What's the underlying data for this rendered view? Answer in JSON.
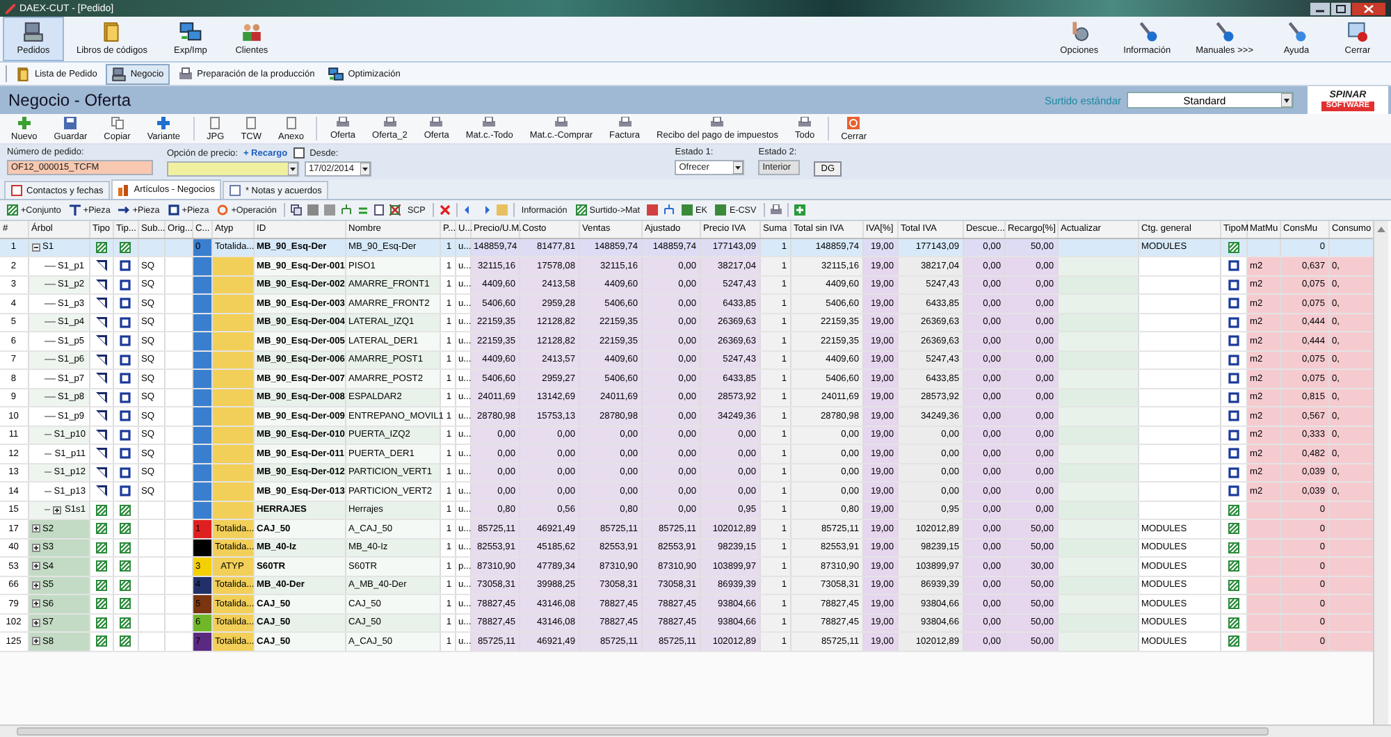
{
  "window": {
    "title": "DAEX-CUT - [Pedido]"
  },
  "ribbon": {
    "items": [
      {
        "label": "Pedidos",
        "selected": true
      },
      {
        "label": "Libros de códigos",
        "selected": false
      },
      {
        "label": "Exp/Imp",
        "selected": false
      },
      {
        "label": "Clientes",
        "selected": false
      }
    ],
    "right_items": [
      "Opciones",
      "Información",
      "Manuales >>>",
      "Ayuda",
      "Cerrar"
    ]
  },
  "nav_tabs": [
    {
      "label": "Lista de Pedido",
      "selected": false
    },
    {
      "label": "Negocio",
      "selected": true
    },
    {
      "label": "Preparación de la producción",
      "selected": false
    },
    {
      "label": "Optimización",
      "selected": false
    }
  ],
  "header": {
    "title": "Negocio - Oferta",
    "assortment_label": "Surtido estándar",
    "assortment_value": "Standard",
    "logo_top": "SPINAR",
    "logo_bottom": "SOFTWARE"
  },
  "toolbar": [
    {
      "kind": "button",
      "label": "Nuevo"
    },
    {
      "kind": "button",
      "label": "Guardar"
    },
    {
      "kind": "button",
      "label": "Copiar"
    },
    {
      "kind": "button",
      "label": "Variante"
    },
    {
      "kind": "separator"
    },
    {
      "kind": "button",
      "label": "JPG"
    },
    {
      "kind": "button",
      "label": "TCW"
    },
    {
      "kind": "button",
      "label": "Anexo"
    },
    {
      "kind": "separator"
    },
    {
      "kind": "button",
      "label": "Oferta"
    },
    {
      "kind": "button",
      "label": "Oferta_2"
    },
    {
      "kind": "button",
      "label": "Oferta"
    },
    {
      "kind": "button",
      "label": "Mat.c.-Todo"
    },
    {
      "kind": "button",
      "label": "Mat.c.-Comprar"
    },
    {
      "kind": "button",
      "label": "Factura"
    },
    {
      "kind": "button",
      "label": "Recibo del pago de impuestos"
    },
    {
      "kind": "button",
      "label": "Todo"
    },
    {
      "kind": "separator"
    },
    {
      "kind": "button",
      "label": "Cerrar"
    }
  ],
  "order": {
    "number_label": "Número de pedido:",
    "number_value": "OF12_000015_TCFM",
    "price_label": "Opción de precio:",
    "surcharge_link": "+ Recargo",
    "from_label": "Desde:",
    "from_checked": false,
    "date": "17/02/2014",
    "state1_label": "Estado 1:",
    "state1_value": "Ofrecer",
    "state2_label": "Estado 2:",
    "state2_value": "Interior",
    "dg_button": "DG"
  },
  "content_tabs": [
    {
      "label": "Contactos y fechas",
      "selected": false
    },
    {
      "label": "Artículos - Negocios",
      "selected": true
    },
    {
      "label": "* Notas y acuerdos",
      "selected": false
    }
  ],
  "grid_toolbar": [
    {
      "kind": "text",
      "label": "+Conjunto"
    },
    {
      "kind": "text",
      "label": "+Pieza"
    },
    {
      "kind": "text",
      "label": "+Pieza"
    },
    {
      "kind": "text",
      "label": "+Pieza"
    },
    {
      "kind": "text",
      "label": "+Operación"
    },
    {
      "kind": "separator"
    },
    {
      "kind": "icon"
    },
    {
      "kind": "icon"
    },
    {
      "kind": "icon"
    },
    {
      "kind": "icon"
    },
    {
      "kind": "icon"
    },
    {
      "kind": "icon"
    },
    {
      "kind": "icon"
    },
    {
      "kind": "text",
      "label": "SCP"
    },
    {
      "kind": "separator"
    },
    {
      "kind": "icon"
    },
    {
      "kind": "separator"
    },
    {
      "kind": "icon"
    },
    {
      "kind": "icon"
    },
    {
      "kind": "icon"
    },
    {
      "kind": "separator"
    },
    {
      "kind": "text",
      "label": "Información"
    },
    {
      "kind": "text",
      "label": "Surtido->Mat"
    },
    {
      "kind": "icon"
    },
    {
      "kind": "icon"
    },
    {
      "kind": "text",
      "label": "EK"
    },
    {
      "kind": "text",
      "label": "E-CSV"
    },
    {
      "kind": "separator"
    },
    {
      "kind": "icon"
    },
    {
      "kind": "separator"
    },
    {
      "kind": "icon"
    }
  ],
  "table": {
    "columns": [
      "#",
      "Árbol",
      "Tipo",
      "Tip...",
      "Sub...",
      "Orig...",
      "C...",
      "Atyp",
      "ID",
      "Nombre",
      "P...",
      "U...",
      "Precio/U.M.",
      "Costo",
      "Ventas",
      "Ajustado",
      "Precio IVA",
      "Suma",
      "Total sin IVA",
      "IVA[%]",
      "Total IVA",
      "Descue...",
      "Recargo[%]",
      "Actualizar",
      "Ctg. general",
      "TipoM",
      "MatMu",
      "ConsMu",
      "Consumo"
    ],
    "rows": [
      {
        "num": "1",
        "tree": "S1",
        "expanded": true,
        "selected": true,
        "tipo": {
          "kind": "set"
        },
        "tip2": {
          "kind": "set"
        },
        "c": "0",
        "color": "#3a7fcf",
        "atyp": "Totalida...",
        "id": "MB_90_Esq-Der",
        "name": "MB_90_Esq-Der",
        "p": "1",
        "u": "u...",
        "values": [
          "148859,74",
          "81477,81",
          "148859,74",
          "148859,74",
          "177143,09",
          "1",
          "148859,74",
          "19,00",
          "177143,09",
          "0,00",
          "50,00"
        ],
        "ctg": "MODULES",
        "tipom": {
          "kind": "set"
        },
        "consmu": "0",
        "children": [
          {
            "num": "2",
            "tree": "S1_p1",
            "selected": false,
            "tipo": {
              "kind": "part"
            },
            "tip2": {
              "kind": "panel"
            },
            "sub": "SQ",
            "color": "#3a7fcf",
            "id": "MB_90_Esq-Der-001",
            "name": "PISO1",
            "p": "1",
            "u": "u...",
            "values": [
              "32115,16",
              "17578,08",
              "32115,16",
              "0,00",
              "38217,04",
              "1",
              "32115,16",
              "19,00",
              "38217,04",
              "0,00",
              "0,00"
            ],
            "tipom": {
              "kind": "panel"
            },
            "matmu": "m2",
            "consmu": "0,637",
            "consumo": "0,"
          },
          {
            "num": "3",
            "tree": "S1_p2",
            "selected": false,
            "tipo": {
              "kind": "part"
            },
            "tip2": {
              "kind": "panel"
            },
            "sub": "SQ",
            "color": "#3a7fcf",
            "id": "MB_90_Esq-Der-002",
            "name": "AMARRE_FRONT1",
            "p": "1",
            "u": "u...",
            "values": [
              "4409,60",
              "2413,58",
              "4409,60",
              "0,00",
              "5247,43",
              "1",
              "4409,60",
              "19,00",
              "5247,43",
              "0,00",
              "0,00"
            ],
            "tipom": {
              "kind": "panel"
            },
            "matmu": "m2",
            "consmu": "0,075",
            "consumo": "0,"
          },
          {
            "num": "4",
            "tree": "S1_p3",
            "selected": false,
            "tipo": {
              "kind": "part"
            },
            "tip2": {
              "kind": "panel"
            },
            "sub": "SQ",
            "color": "#3a7fcf",
            "id": "MB_90_Esq-Der-003",
            "name": "AMARRE_FRONT2",
            "p": "1",
            "u": "u...",
            "values": [
              "5406,60",
              "2959,28",
              "5406,60",
              "0,00",
              "6433,85",
              "1",
              "5406,60",
              "19,00",
              "6433,85",
              "0,00",
              "0,00"
            ],
            "tipom": {
              "kind": "panel"
            },
            "matmu": "m2",
            "consmu": "0,075",
            "consumo": "0,"
          },
          {
            "num": "5",
            "tree": "S1_p4",
            "selected": false,
            "tipo": {
              "kind": "part"
            },
            "tip2": {
              "kind": "panel"
            },
            "sub": "SQ",
            "color": "#3a7fcf",
            "id": "MB_90_Esq-Der-004",
            "name": "LATERAL_IZQ1",
            "p": "1",
            "u": "u...",
            "values": [
              "22159,35",
              "12128,82",
              "22159,35",
              "0,00",
              "26369,63",
              "1",
              "22159,35",
              "19,00",
              "26369,63",
              "0,00",
              "0,00"
            ],
            "tipom": {
              "kind": "panel"
            },
            "matmu": "m2",
            "consmu": "0,444",
            "consumo": "0,"
          },
          {
            "num": "6",
            "tree": "S1_p5",
            "selected": false,
            "tipo": {
              "kind": "part"
            },
            "tip2": {
              "kind": "panel"
            },
            "sub": "SQ",
            "color": "#3a7fcf",
            "id": "MB_90_Esq-Der-005",
            "name": "LATERAL_DER1",
            "p": "1",
            "u": "u...",
            "values": [
              "22159,35",
              "12128,82",
              "22159,35",
              "0,00",
              "26369,63",
              "1",
              "22159,35",
              "19,00",
              "26369,63",
              "0,00",
              "0,00"
            ],
            "tipom": {
              "kind": "panel"
            },
            "matmu": "m2",
            "consmu": "0,444",
            "consumo": "0,"
          },
          {
            "num": "7",
            "tree": "S1_p6",
            "selected": false,
            "tipo": {
              "kind": "part"
            },
            "tip2": {
              "kind": "panel"
            },
            "sub": "SQ",
            "color": "#3a7fcf",
            "id": "MB_90_Esq-Der-006",
            "name": "AMARRE_POST1",
            "p": "1",
            "u": "u...",
            "values": [
              "4409,60",
              "2413,57",
              "4409,60",
              "0,00",
              "5247,43",
              "1",
              "4409,60",
              "19,00",
              "5247,43",
              "0,00",
              "0,00"
            ],
            "tipom": {
              "kind": "panel"
            },
            "matmu": "m2",
            "consmu": "0,075",
            "consumo": "0,"
          },
          {
            "num": "8",
            "tree": "S1_p7",
            "selected": false,
            "tipo": {
              "kind": "part"
            },
            "tip2": {
              "kind": "panel"
            },
            "sub": "SQ",
            "color": "#3a7fcf",
            "id": "MB_90_Esq-Der-007",
            "name": "AMARRE_POST2",
            "p": "1",
            "u": "u...",
            "values": [
              "5406,60",
              "2959,27",
              "5406,60",
              "0,00",
              "6433,85",
              "1",
              "5406,60",
              "19,00",
              "6433,85",
              "0,00",
              "0,00"
            ],
            "tipom": {
              "kind": "panel"
            },
            "matmu": "m2",
            "consmu": "0,075",
            "consumo": "0,"
          },
          {
            "num": "9",
            "tree": "S1_p8",
            "selected": false,
            "tipo": {
              "kind": "part"
            },
            "tip2": {
              "kind": "panel"
            },
            "sub": "SQ",
            "color": "#3a7fcf",
            "id": "MB_90_Esq-Der-008",
            "name": "ESPALDAR2",
            "p": "1",
            "u": "u...",
            "values": [
              "24011,69",
              "13142,69",
              "24011,69",
              "0,00",
              "28573,92",
              "1",
              "24011,69",
              "19,00",
              "28573,92",
              "0,00",
              "0,00"
            ],
            "tipom": {
              "kind": "panel"
            },
            "matmu": "m2",
            "consmu": "0,815",
            "consumo": "0,"
          },
          {
            "num": "10",
            "tree": "S1_p9",
            "selected": false,
            "tipo": {
              "kind": "part"
            },
            "tip2": {
              "kind": "panel"
            },
            "sub": "SQ",
            "color": "#3a7fcf",
            "id": "MB_90_Esq-Der-009",
            "name": "ENTREPANO_MOVIL1",
            "p": "1",
            "u": "u...",
            "values": [
              "28780,98",
              "15753,13",
              "28780,98",
              "0,00",
              "34249,36",
              "1",
              "28780,98",
              "19,00",
              "34249,36",
              "0,00",
              "0,00"
            ],
            "tipom": {
              "kind": "panel"
            },
            "matmu": "m2",
            "consmu": "0,567",
            "consumo": "0,"
          },
          {
            "num": "11",
            "tree": "S1_p10",
            "selected": false,
            "tipo": {
              "kind": "part"
            },
            "tip2": {
              "kind": "panel"
            },
            "sub": "SQ",
            "color": "#3a7fcf",
            "id": "MB_90_Esq-Der-010",
            "name": "PUERTA_IZQ2",
            "p": "1",
            "u": "u...",
            "values": [
              "0,00",
              "0,00",
              "0,00",
              "0,00",
              "0,00",
              "1",
              "0,00",
              "19,00",
              "0,00",
              "0,00",
              "0,00"
            ],
            "tipom": {
              "kind": "panel"
            },
            "matmu": "m2",
            "consmu": "0,333",
            "consumo": "0,"
          },
          {
            "num": "12",
            "tree": "S1_p11",
            "selected": false,
            "tipo": {
              "kind": "part"
            },
            "tip2": {
              "kind": "panel"
            },
            "sub": "SQ",
            "color": "#3a7fcf",
            "id": "MB_90_Esq-Der-011",
            "name": "PUERTA_DER1",
            "p": "1",
            "u": "u...",
            "values": [
              "0,00",
              "0,00",
              "0,00",
              "0,00",
              "0,00",
              "1",
              "0,00",
              "19,00",
              "0,00",
              "0,00",
              "0,00"
            ],
            "tipom": {
              "kind": "panel"
            },
            "matmu": "m2",
            "consmu": "0,482",
            "consumo": "0,"
          },
          {
            "num": "13",
            "tree": "S1_p12",
            "selected": false,
            "tipo": {
              "kind": "part"
            },
            "tip2": {
              "kind": "panel"
            },
            "sub": "SQ",
            "color": "#3a7fcf",
            "id": "MB_90_Esq-Der-012",
            "name": "PARTICION_VERT1",
            "p": "1",
            "u": "u...",
            "values": [
              "0,00",
              "0,00",
              "0,00",
              "0,00",
              "0,00",
              "1",
              "0,00",
              "19,00",
              "0,00",
              "0,00",
              "0,00"
            ],
            "tipom": {
              "kind": "panel"
            },
            "matmu": "m2",
            "consmu": "0,039",
            "consumo": "0,"
          },
          {
            "num": "14",
            "tree": "S1_p13",
            "selected": false,
            "tipo": {
              "kind": "part"
            },
            "tip2": {
              "kind": "panel"
            },
            "sub": "SQ",
            "color": "#3a7fcf",
            "id": "MB_90_Esq-Der-013",
            "name": "PARTICION_VERT2",
            "p": "1",
            "u": "u...",
            "values": [
              "0,00",
              "0,00",
              "0,00",
              "0,00",
              "0,00",
              "1",
              "0,00",
              "19,00",
              "0,00",
              "0,00",
              "0,00"
            ],
            "tipom": {
              "kind": "panel"
            },
            "matmu": "m2",
            "consmu": "0,039",
            "consumo": "0,"
          },
          {
            "num": "15",
            "tree": "S1s1",
            "expanded": false,
            "selected": false,
            "tipo": {
              "kind": "set"
            },
            "tip2": {
              "kind": "set"
            },
            "color": "#3a7fcf",
            "id": "HERRAJES",
            "name": "Herrajes",
            "p": "1",
            "u": "u...",
            "values": [
              "0,80",
              "0,56",
              "0,80",
              "0,00",
              "0,95",
              "1",
              "0,80",
              "19,00",
              "0,95",
              "0,00",
              "0,00"
            ],
            "tipom": {
              "kind": "set"
            },
            "consmu": "0"
          }
        ]
      },
      {
        "num": "17",
        "tree": "S2",
        "expanded": false,
        "selected": false,
        "tipo": {
          "kind": "set"
        },
        "tip2": {
          "kind": "set"
        },
        "c": "1",
        "color": "#e02020",
        "atyp": "Totalida...",
        "id": "CAJ_50",
        "name": "A_CAJ_50",
        "p": "1",
        "u": "u...",
        "values": [
          "85725,11",
          "46921,49",
          "85725,11",
          "85725,11",
          "102012,89",
          "1",
          "85725,11",
          "19,00",
          "102012,89",
          "0,00",
          "50,00"
        ],
        "ctg": "MODULES",
        "tipom": {
          "kind": "set"
        },
        "consmu": "0"
      },
      {
        "num": "40",
        "tree": "S3",
        "expanded": false,
        "selected": false,
        "tipo": {
          "kind": "set"
        },
        "tip2": {
          "kind": "set"
        },
        "color": "#000000",
        "atyp": "Totalida...",
        "id": "MB_40-Iz",
        "name": "MB_40-Iz",
        "p": "1",
        "u": "u...",
        "values": [
          "82553,91",
          "45185,62",
          "82553,91",
          "82553,91",
          "98239,15",
          "1",
          "82553,91",
          "19,00",
          "98239,15",
          "0,00",
          "50,00"
        ],
        "ctg": "MODULES",
        "tipom": {
          "kind": "set"
        },
        "consmu": "0"
      },
      {
        "num": "53",
        "tree": "S4",
        "expanded": false,
        "selected": false,
        "tipo": {
          "kind": "set"
        },
        "tip2": {
          "kind": "set"
        },
        "c": "3",
        "color": "#f5d000",
        "atyp": "ATYP",
        "id": "S60TR",
        "name": "S60TR",
        "p": "1",
        "u": "p...",
        "values": [
          "87310,90",
          "47789,34",
          "87310,90",
          "87310,90",
          "103899,97",
          "1",
          "87310,90",
          "19,00",
          "103899,97",
          "0,00",
          "30,00"
        ],
        "ctg": "MODULES",
        "tipom": {
          "kind": "set"
        },
        "consmu": "0"
      },
      {
        "num": "66",
        "tree": "S5",
        "expanded": false,
        "selected": false,
        "tipo": {
          "kind": "set"
        },
        "tip2": {
          "kind": "set"
        },
        "c": "4",
        "color": "#22306a",
        "atyp": "Totalida...",
        "id": "MB_40-Der",
        "name": "A_MB_40-Der",
        "p": "1",
        "u": "u...",
        "values": [
          "73058,31",
          "39988,25",
          "73058,31",
          "73058,31",
          "86939,39",
          "1",
          "73058,31",
          "19,00",
          "86939,39",
          "0,00",
          "50,00"
        ],
        "ctg": "MODULES",
        "tipom": {
          "kind": "set"
        },
        "consmu": "0"
      },
      {
        "num": "79",
        "tree": "S6",
        "expanded": false,
        "selected": false,
        "tipo": {
          "kind": "set"
        },
        "tip2": {
          "kind": "set"
        },
        "c": "5",
        "color": "#7a3510",
        "atyp": "Totalida...",
        "id": "CAJ_50",
        "name": "CAJ_50",
        "p": "1",
        "u": "u...",
        "values": [
          "78827,45",
          "43146,08",
          "78827,45",
          "78827,45",
          "93804,66",
          "1",
          "78827,45",
          "19,00",
          "93804,66",
          "0,00",
          "50,00"
        ],
        "ctg": "MODULES",
        "tipom": {
          "kind": "set"
        },
        "consmu": "0"
      },
      {
        "num": "102",
        "tree": "S7",
        "expanded": false,
        "selected": false,
        "tipo": {
          "kind": "set"
        },
        "tip2": {
          "kind": "set"
        },
        "c": "6",
        "color": "#70b82a",
        "atyp": "Totalida...",
        "id": "CAJ_50",
        "name": "CAJ_50",
        "p": "1",
        "u": "u...",
        "values": [
          "78827,45",
          "43146,08",
          "78827,45",
          "78827,45",
          "93804,66",
          "1",
          "78827,45",
          "19,00",
          "93804,66",
          "0,00",
          "50,00"
        ],
        "ctg": "MODULES",
        "tipom": {
          "kind": "set"
        },
        "consmu": "0"
      },
      {
        "num": "125",
        "tree": "S8",
        "expanded": false,
        "selected": false,
        "tipo": {
          "kind": "set"
        },
        "tip2": {
          "kind": "set"
        },
        "c": "7",
        "color": "#5a2a80",
        "atyp": "Totalida...",
        "id": "CAJ_50",
        "name": "A_CAJ_50",
        "p": "1",
        "u": "u...",
        "values": [
          "85725,11",
          "46921,49",
          "85725,11",
          "85725,11",
          "102012,89",
          "1",
          "85725,11",
          "19,00",
          "102012,89",
          "0,00",
          "50,00"
        ],
        "ctg": "MODULES",
        "tipom": {
          "kind": "set"
        },
        "consmu": "0"
      }
    ]
  }
}
